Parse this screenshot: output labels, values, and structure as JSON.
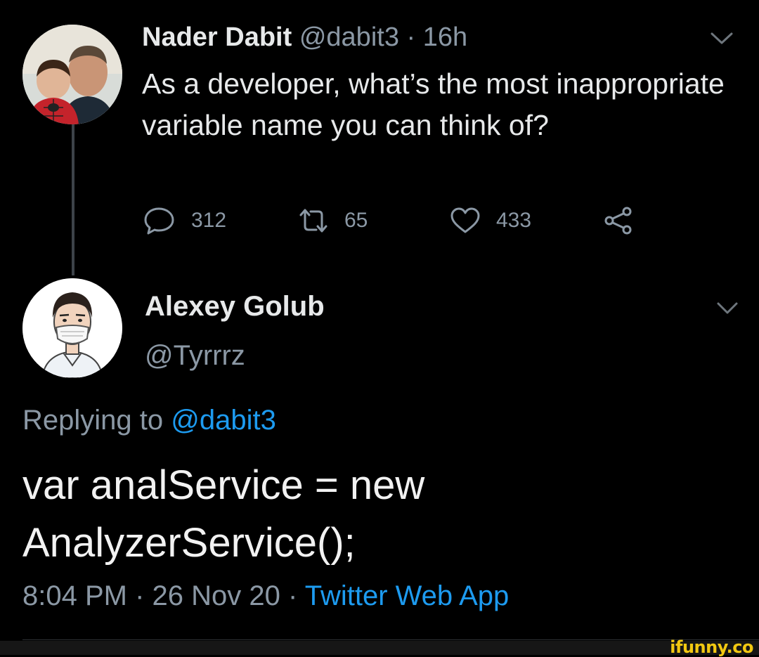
{
  "tweet1": {
    "name": "Nader Dabit",
    "handle": "@dabit3",
    "separator": "·",
    "time": "16h",
    "text": "As a developer, what’s the most inappropriate variable name you can think of?",
    "actions": {
      "reply_icon": "reply-icon",
      "reply_count": "312",
      "retweet_icon": "retweet-icon",
      "retweet_count": "65",
      "like_icon": "heart-icon",
      "like_count": "433",
      "share_icon": "share-icon"
    }
  },
  "tweet2": {
    "name": "Alexey Golub",
    "handle": "@Tyrrrz",
    "replying_prefix": "Replying to",
    "replying_handle": "@dabit3",
    "text": "var analService = new AnalyzerService();",
    "time": "8:04 PM",
    "separator": "·",
    "date": "26 Nov 20",
    "separator2": "·",
    "source": "Twitter Web App"
  },
  "watermark": "ifunny.co",
  "colors": {
    "background": "#000000",
    "text": "#e7e9ea",
    "secondary": "#8b98a5",
    "link": "#1d9bf0",
    "thread_line": "#3d4349",
    "watermark": "#f2c811"
  }
}
